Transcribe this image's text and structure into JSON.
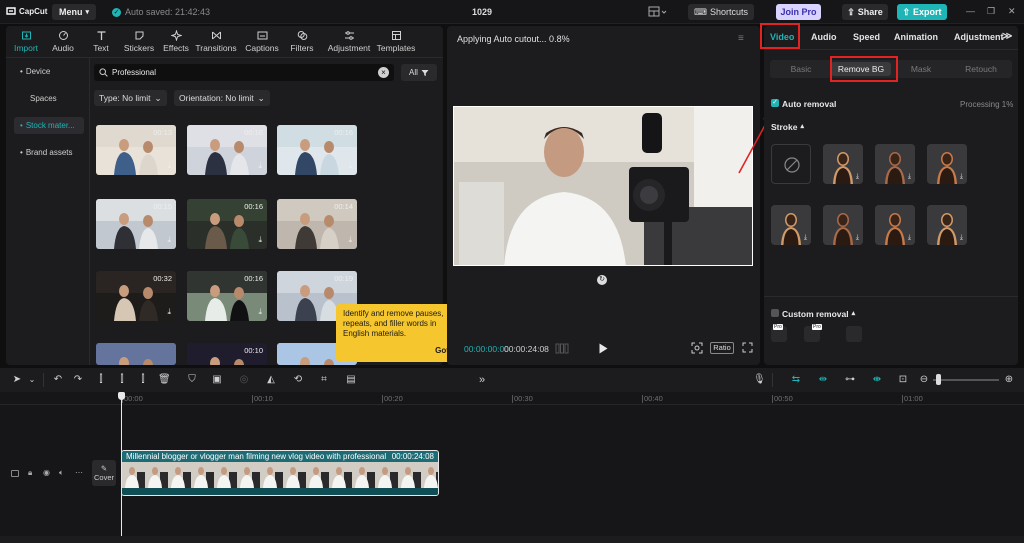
{
  "titlebar": {
    "app_name": "CapCut",
    "menu_label": "Menu",
    "autosave_text": "Auto saved: 21:42:43",
    "project_title": "1029",
    "shortcuts_label": "Shortcuts",
    "join_pro_label": "Join Pro",
    "share_label": "Share",
    "export_label": "Export"
  },
  "media_tabs": [
    {
      "label": "Import",
      "icon": "import-icon",
      "active": true
    },
    {
      "label": "Audio",
      "icon": "audio-icon"
    },
    {
      "label": "Text",
      "icon": "text-icon"
    },
    {
      "label": "Stickers",
      "icon": "stickers-icon"
    },
    {
      "label": "Effects",
      "icon": "effects-icon"
    },
    {
      "label": "Transitions",
      "icon": "transitions-icon"
    },
    {
      "label": "Captions",
      "icon": "captions-icon"
    },
    {
      "label": "Filters",
      "icon": "filters-icon"
    },
    {
      "label": "Adjustment",
      "icon": "adjustment-icon"
    },
    {
      "label": "Templates",
      "icon": "templates-icon"
    }
  ],
  "side_nav": [
    {
      "label": "Device"
    },
    {
      "label": "Spaces"
    },
    {
      "label": "Stock mater..."
    },
    {
      "label": "Brand assets"
    }
  ],
  "search": {
    "value": "Professional",
    "all_label": "All"
  },
  "filters": {
    "type_label": "Type: No limit",
    "orientation_label": "Orientation: No limit"
  },
  "media_grid": [
    {
      "duration": "00:13",
      "colors": [
        "#dcd6cc",
        "#3e5f8a",
        "#e8e2d8"
      ]
    },
    {
      "duration": "00:16",
      "colors": [
        "#e4e6ea",
        "#2b3140",
        "#cfd4dc"
      ]
    },
    {
      "duration": "00:16",
      "colors": [
        "#c9d8e0",
        "#324766",
        "#dfe6ec"
      ]
    },
    {
      "duration": "00:15",
      "colors": [
        "#e6e8ea",
        "#2f2f36",
        "#c2c8d0"
      ]
    },
    {
      "duration": "00:16",
      "colors": [
        "#3a4a38",
        "#6a5a4a",
        "#2a2f2a"
      ]
    },
    {
      "duration": "00:14",
      "colors": [
        "#d6d0c6",
        "#403a36",
        "#bfb7ad"
      ]
    },
    {
      "duration": "00:32",
      "colors": [
        "#2f2a26",
        "#d6c6b4",
        "#1e1c1a"
      ]
    },
    {
      "duration": "00:16",
      "colors": [
        "#111113",
        "#e8ece8",
        "#7a8a78"
      ]
    },
    {
      "duration": "00:19",
      "colors": [
        "#d8dde2",
        "#3c4150",
        "#b9c2cc"
      ]
    },
    {
      "duration": "",
      "colors": [
        "#6f7fa8",
        "#e2c8a0",
        "#4d5a80"
      ]
    },
    {
      "duration": "00:10",
      "colors": [
        "#1a1a2a",
        "#4a3a5a",
        "#2a2236"
      ]
    },
    {
      "duration": "",
      "colors": [
        "#b8d0ea",
        "#ffffff",
        "#8ab0d8"
      ]
    }
  ],
  "tooltip": {
    "text": "Identify and remove pauses, repeats, and filler words in English materials.",
    "button": "Got it"
  },
  "player": {
    "status": "Applying Auto cutout... 0.8%",
    "current_time": "00:00:00:00",
    "total_time": "00:00:24:08",
    "ratio_label": "Ratio"
  },
  "right_panel": {
    "tabs": [
      {
        "label": "Video",
        "active": true
      },
      {
        "label": "Audio"
      },
      {
        "label": "Speed"
      },
      {
        "label": "Animation"
      },
      {
        "label": "Adjustment"
      }
    ],
    "subtabs": [
      {
        "label": "Basic"
      },
      {
        "label": "Remove BG",
        "active": true
      },
      {
        "label": "Mask"
      },
      {
        "label": "Retouch"
      }
    ],
    "auto_removal_label": "Auto removal",
    "processing_text": "Processing 1%",
    "stroke_label": "Stroke",
    "custom_removal_label": "Custom removal",
    "pro_badge": "Pro"
  },
  "timeline": {
    "ruler_labels": [
      "00:00",
      "00:10",
      "00:20",
      "00:30",
      "00:40",
      "00:50",
      "01:00"
    ],
    "clip_title": "Millennial blogger or vlogger man filming new vlog video with professional",
    "clip_duration": "00:00:24:08",
    "cover_label": "Cover"
  },
  "colors": {
    "accent": "#1fb5b6",
    "highlight_box": "#e02424",
    "tooltip_bg": "#f6c62e",
    "join_pro_bg": "#d9d4ff",
    "export_bg": "#1fb5b6"
  }
}
